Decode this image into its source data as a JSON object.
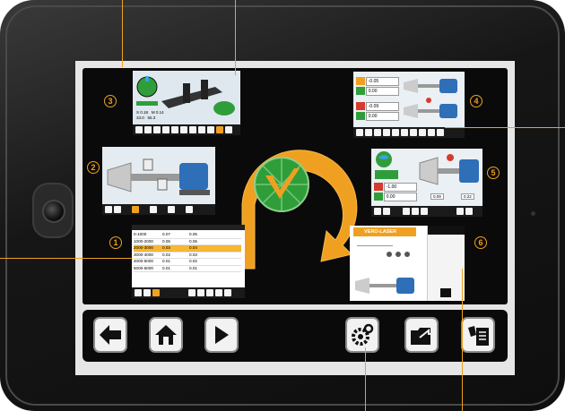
{
  "callouts": {
    "c1": "1",
    "c2": "2",
    "c3": "3",
    "c4": "4",
    "c5": "5",
    "c6": "6"
  },
  "thumb_table": {
    "rows": [
      [
        "0-1000",
        "0.07",
        "0.05"
      ],
      [
        "1000-2000",
        "0.05",
        "0.05"
      ],
      [
        "2000-3000",
        "0.03",
        "0.04"
      ],
      [
        "3000-4000",
        "0.02",
        "0.03"
      ],
      [
        "4000-5000",
        "0.01",
        "0.02"
      ],
      [
        "5000-6000",
        "0.01",
        "0.01"
      ]
    ],
    "highlight_row": 2
  },
  "thumb_misalign": {
    "row1": "-0.05",
    "row2": "0.00",
    "row3": "-0.09",
    "row4": "0.00"
  },
  "thumb_result": {
    "row1": "-1.00",
    "row2": "0.00",
    "meas1": "0.09",
    "meas2": "0.22"
  },
  "thumb_measure": {
    "s_label": "S",
    "m_label": "M",
    "s_value1": "0.18",
    "m_value1": "0.14",
    "s_value2": "33.0",
    "m_value2": "55.3"
  },
  "thumb_about": {
    "brand": "VERO-LASER"
  },
  "colors": {
    "accent": "#f0a020",
    "logo_green": "#2f9e3a",
    "screen_bg": "#e6e6e6",
    "panel_bg": "#0a0a0a"
  },
  "navbar": {
    "icons": [
      "arrow-left-icon",
      "home-icon",
      "play-icon",
      "settings-gear-icon",
      "folder-export-icon",
      "report-icon"
    ]
  }
}
